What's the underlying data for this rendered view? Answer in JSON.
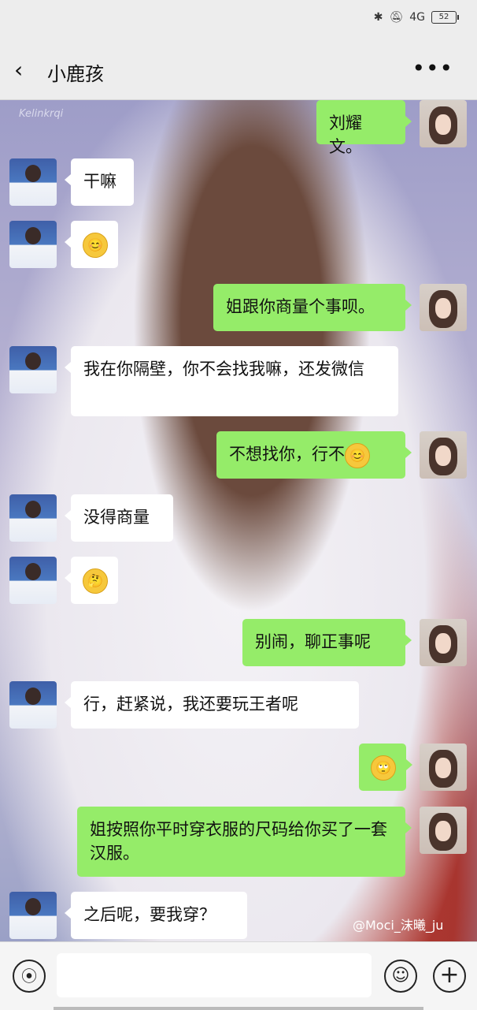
{
  "status_bar": {
    "network": "4G",
    "battery": "52",
    "icons": [
      "bluetooth-icon",
      "mute-icon",
      "signal-icon",
      "battery-icon"
    ]
  },
  "header": {
    "title": "小鹿孩",
    "back_icon": "chevron-left-icon",
    "more_icon": "more-dots-icon"
  },
  "watermarks": {
    "top_left": "Kelinkrqi",
    "bottom_right": "@Moci_沫曦_ju"
  },
  "messages": [
    {
      "side": "out",
      "text": "刘耀文。"
    },
    {
      "side": "in",
      "text": "干嘛"
    },
    {
      "side": "in",
      "emoji": "😊"
    },
    {
      "side": "out",
      "text": "姐跟你商量个事呗。"
    },
    {
      "side": "in",
      "text": "我在你隔壁，你不会找我嘛，还发微信"
    },
    {
      "side": "out",
      "text": "不想找你，行不",
      "emoji": "😊"
    },
    {
      "side": "in",
      "text": "没得商量"
    },
    {
      "side": "in",
      "emoji": "🤔"
    },
    {
      "side": "out",
      "text": "别闹，聊正事呢"
    },
    {
      "side": "in",
      "text": "行，赶紧说，我还要玩王者呢"
    },
    {
      "side": "out",
      "emoji": "🙄"
    },
    {
      "side": "out",
      "text": "姐按照你平时穿衣服的尺码给你买了一套汉服。"
    },
    {
      "side": "in",
      "text": "之后呢，要我穿？"
    }
  ],
  "input_bar": {
    "voice_icon": "voice-icon",
    "emoji_icon": "emoji-icon",
    "plus_icon": "plus-icon"
  }
}
